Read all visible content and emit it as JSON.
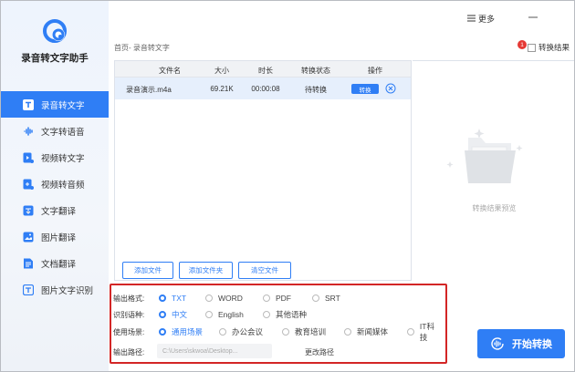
{
  "app": {
    "title": "录音转文字助手"
  },
  "titlebar": {
    "more_label": "更多"
  },
  "sidebar": {
    "items": [
      {
        "label": "录音转文字",
        "icon": "text-t-icon",
        "active": true
      },
      {
        "label": "文字转语音",
        "icon": "voice-wave-icon"
      },
      {
        "label": "视频转文字",
        "icon": "video-play-icon"
      },
      {
        "label": "视频转音频",
        "icon": "video-audio-icon"
      },
      {
        "label": "文字翻译",
        "icon": "translate-icon"
      },
      {
        "label": "图片翻译",
        "icon": "image-icon"
      },
      {
        "label": "文档翻译",
        "icon": "document-icon"
      },
      {
        "label": "图片文字识别",
        "icon": "ocr-icon"
      }
    ]
  },
  "breadcrumb": "首页- 录音转文字",
  "result_toggle": {
    "label": "转换结果",
    "badge": "1"
  },
  "table": {
    "headers": [
      "文件名",
      "大小",
      "时长",
      "转换状态",
      "操作"
    ],
    "rows": [
      {
        "name": "录音演示.m4a",
        "size": "69.21K",
        "duration": "00:00:08",
        "status": "待转换",
        "action": "转换"
      }
    ]
  },
  "buttons": {
    "add_file": "添加文件",
    "add_folder": "添加文件夹",
    "clear": "清空文件"
  },
  "preview": {
    "text": "转换结果预览"
  },
  "options": {
    "format": {
      "label": "输出格式:",
      "choices": [
        "TXT",
        "WORD",
        "PDF",
        "SRT"
      ],
      "selected": "TXT"
    },
    "language": {
      "label": "识别语种:",
      "choices": [
        "中文",
        "English",
        "其他语种"
      ],
      "selected": "中文"
    },
    "scene": {
      "label": "使用场景:",
      "choices": [
        "通用场景",
        "办公会议",
        "教育培训",
        "新闻媒体",
        "IT科技"
      ],
      "selected": "通用场景"
    },
    "path": {
      "label": "输出路径:",
      "value": "C:\\Users\\skwoa\\Desktop...",
      "change_label": "更改路径"
    }
  },
  "start": {
    "label": "开始转换"
  },
  "colors": {
    "accent": "#2f7ef5",
    "highlight_border": "#d32626",
    "badge": "#e53935"
  }
}
